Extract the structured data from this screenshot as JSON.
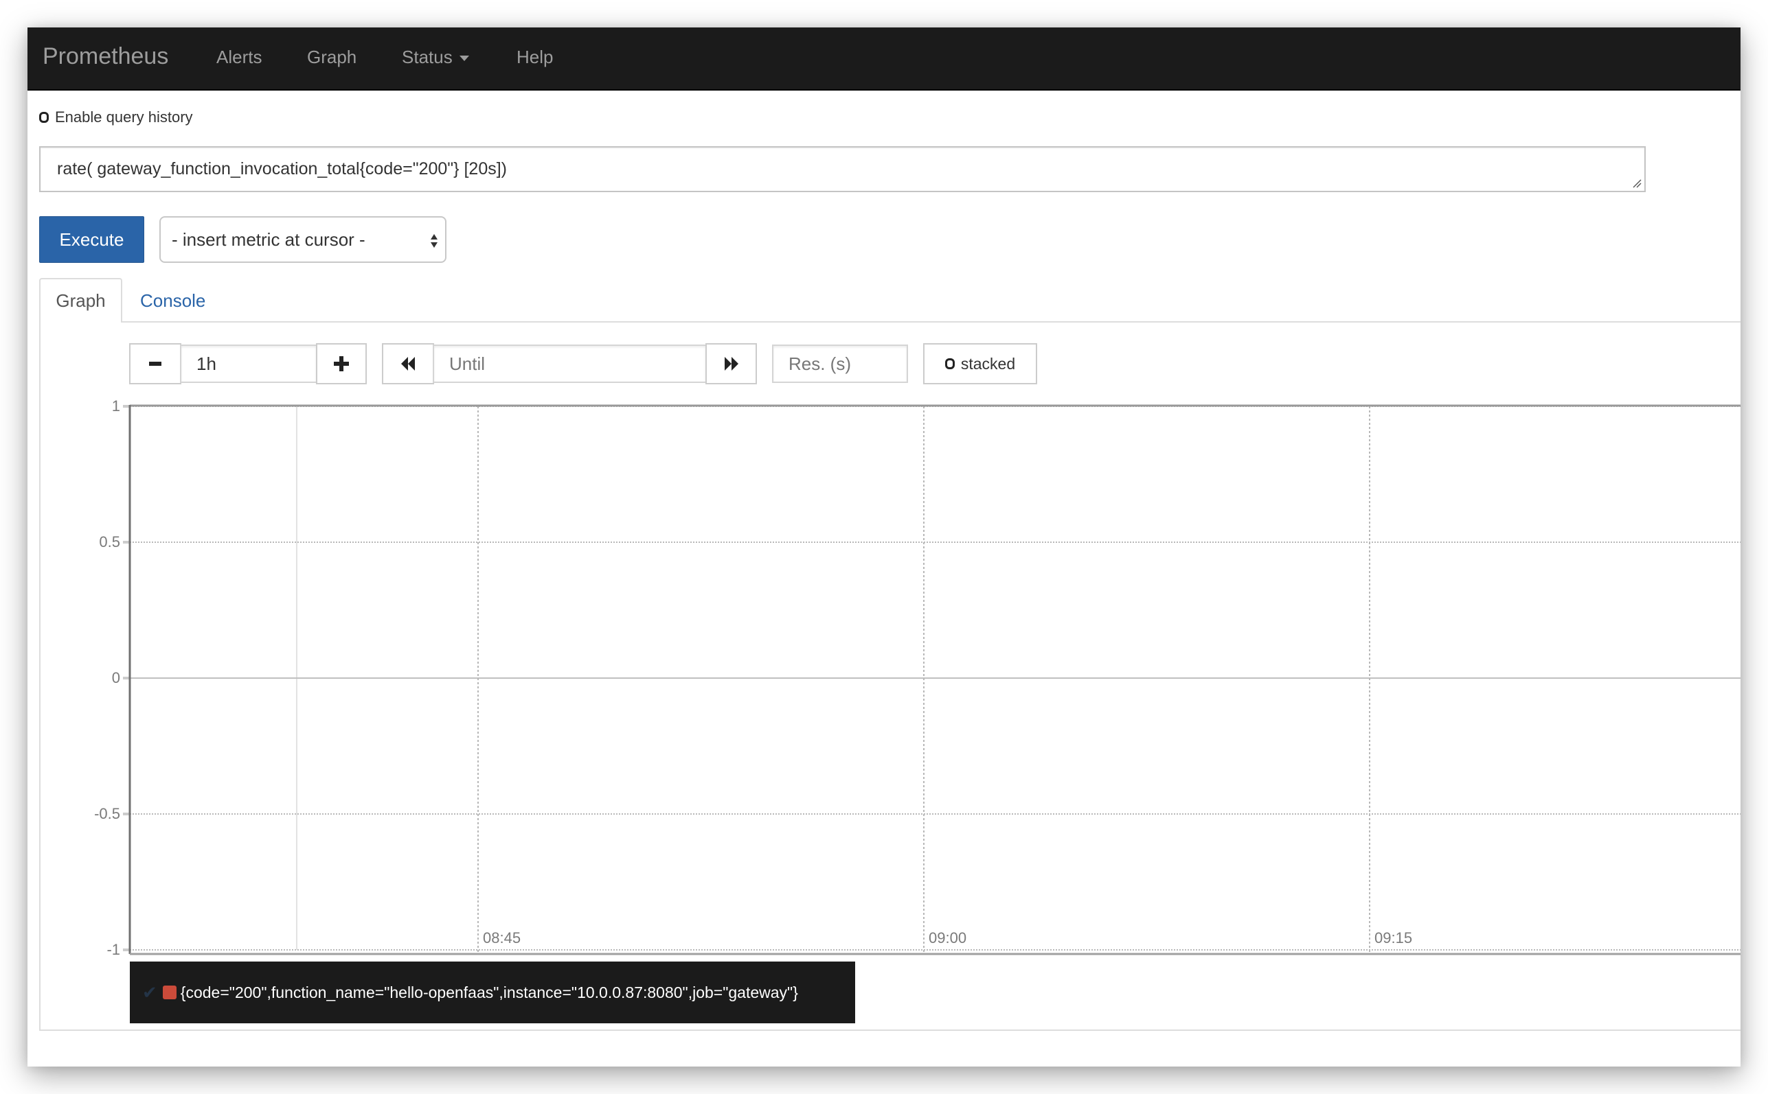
{
  "navbar": {
    "brand": "Prometheus",
    "items": [
      {
        "label": "Alerts"
      },
      {
        "label": "Graph"
      },
      {
        "label": "Status",
        "has_dropdown": true
      },
      {
        "label": "Help"
      }
    ]
  },
  "query_history": {
    "label": "Enable query history",
    "checked": false
  },
  "expression": {
    "value": "rate( gateway_function_invocation_total{code=\"200\"} [20s])"
  },
  "execute_button": {
    "label": "Execute"
  },
  "metric_select": {
    "selected": "- insert metric at cursor -"
  },
  "tabs": [
    {
      "label": "Graph",
      "active": true
    },
    {
      "label": "Console",
      "active": false
    }
  ],
  "graph_controls": {
    "range_minus": "−",
    "range_value": "1h",
    "range_plus": "+",
    "back_icon": "rewind-icon",
    "until_placeholder": "Until",
    "forward_icon": "fast-forward-icon",
    "resolution_placeholder": "Res. (s)",
    "stacked_label": "stacked",
    "stacked_checked": false
  },
  "chart_data": {
    "type": "line",
    "title": "",
    "xlabel": "",
    "ylabel": "",
    "ylim": [
      -1,
      1
    ],
    "yticks": [
      "1",
      "0.5",
      "0",
      "-0.5",
      "-1"
    ],
    "ytick_values": [
      1,
      0.5,
      0,
      -0.5,
      -1
    ],
    "xticks": [
      "08:45",
      "09:00",
      "09:15"
    ],
    "xlim": [
      "08:33",
      "09:28"
    ],
    "grid": true,
    "series": [
      {
        "name": "{code=\"200\",function_name=\"hello-openfaas\",instance=\"10.0.0.87:8080\",job=\"gateway\"}",
        "color": "#cb4b3a",
        "values": []
      }
    ],
    "legend_position": "bottom-left"
  },
  "legend": {
    "items": [
      {
        "checked": true,
        "color": "#cb4b3a",
        "label": "{code=\"200\",function_name=\"hello-openfaas\",instance=\"10.0.0.87:8080\",job=\"gateway\"}"
      }
    ]
  }
}
